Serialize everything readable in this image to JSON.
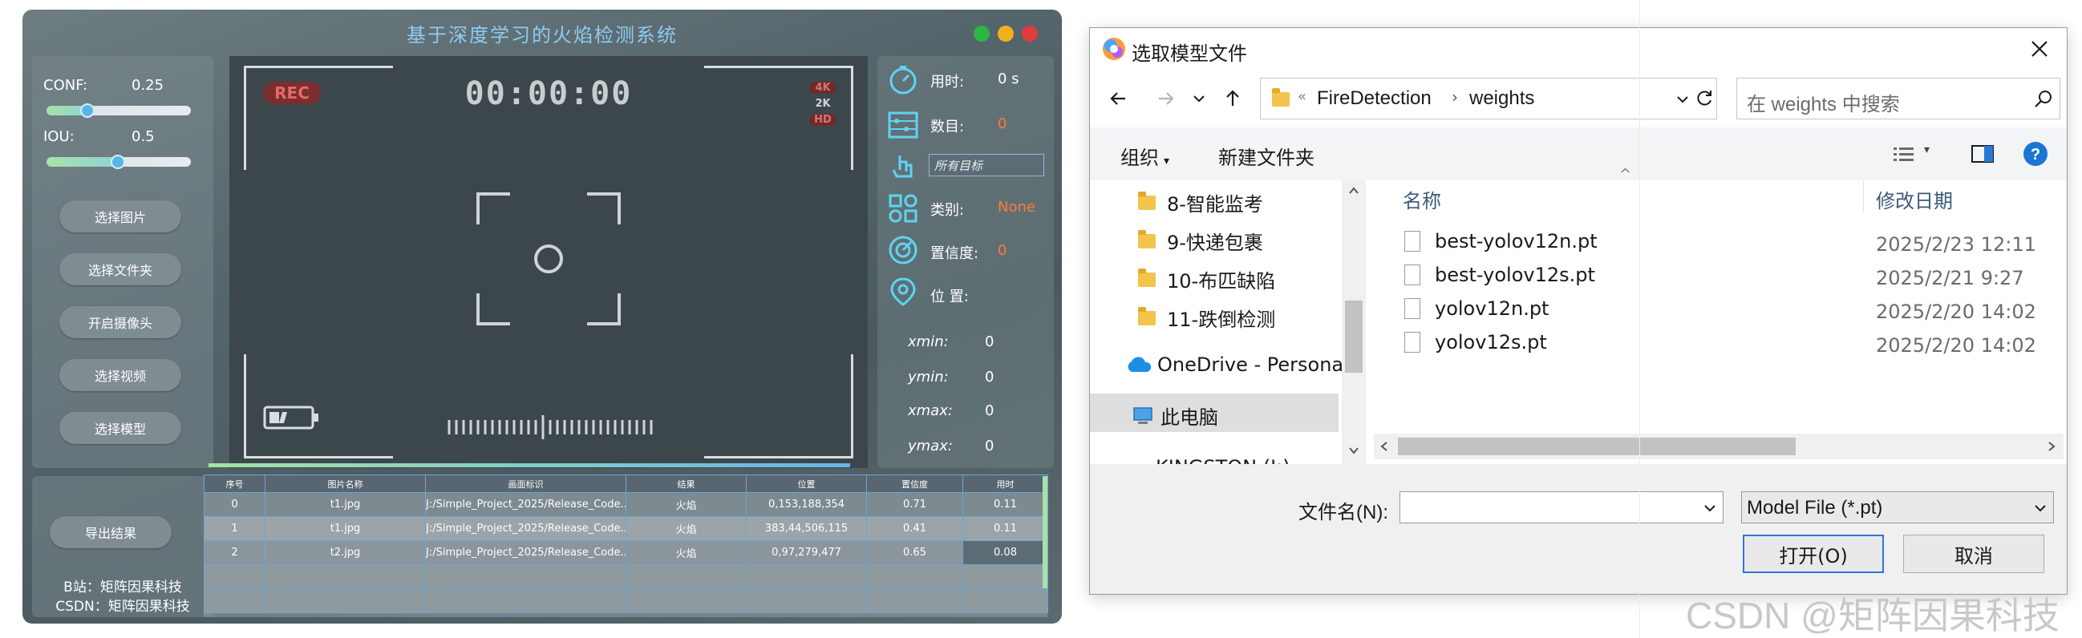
{
  "app": {
    "title": "基于深度学习的火焰检测系统",
    "colors": {
      "close": "#e23b3b",
      "minimize": "#f2b01e",
      "maximize": "#2cb742"
    },
    "conf": {
      "label": "CONF:",
      "value": "0.25",
      "level": 0.25
    },
    "iou": {
      "label": "IOU:",
      "value": "0.5",
      "level": 0.5
    },
    "buttons": {
      "select_image": "选择图片",
      "select_folder": "选择文件夹",
      "open_camera": "开启摄像头",
      "select_video": "选择视频",
      "select_model": "选择模型",
      "export": "导出结果"
    },
    "video": {
      "rec": "REC",
      "timer": "00:00:00",
      "res_4k": "4K",
      "res_2k": "2K",
      "res_hd": "HD"
    },
    "info": {
      "time_label": "用时:",
      "time_value": "0 s",
      "count_label": "数目:",
      "count_value": "0",
      "target_select": "所有目标",
      "class_label": "类别:",
      "class_value": "None",
      "conf_label": "置信度:",
      "conf_value": "0",
      "pos_label": "位 置:",
      "xmin_label": "xmin:",
      "xmin_value": "0",
      "ymin_label": "ymin:",
      "ymin_value": "0",
      "xmax_label": "xmax:",
      "xmax_value": "0",
      "ymax_label": "ymax:",
      "ymax_value": "0"
    },
    "credits": {
      "bilibili": "B站：矩阵因果科技",
      "csdn": "CSDN：矩阵因果科技"
    },
    "table": {
      "headers": [
        "序号",
        "图片名称",
        "画面标识",
        "结果",
        "位置",
        "置信度",
        "用时"
      ],
      "rows": [
        [
          "0",
          "t1.jpg",
          "J:/Simple_Project_2025/Release_Code...",
          "火焰",
          "0,153,188,354",
          "0.71",
          "0.11"
        ],
        [
          "1",
          "t1.jpg",
          "J:/Simple_Project_2025/Release_Code...",
          "火焰",
          "383,44,506,115",
          "0.41",
          "0.11"
        ],
        [
          "2",
          "t2.jpg",
          "J:/Simple_Project_2025/Release_Code...",
          "火焰",
          "0,97,279,477",
          "0.65",
          "0.08"
        ]
      ]
    }
  },
  "dialog": {
    "title": "选取模型文件",
    "breadcrumb": [
      "FireDetection",
      "weights"
    ],
    "search_placeholder": "在 weights 中搜索",
    "toolbar": {
      "organize": "组织",
      "new_folder": "新建文件夹"
    },
    "nav_items": [
      "8-智能监考",
      "9-快递包裹",
      "10-布匹缺陷",
      "11-跌倒检测"
    ],
    "onedrive": "OneDrive - Persona",
    "this_pc": "此电脑",
    "kingston": "KINGSTON (J:)",
    "columns": {
      "name": "名称",
      "date": "修改日期"
    },
    "files": [
      {
        "name": "best-yolov12n.pt",
        "date": "2025/2/23 12:11"
      },
      {
        "name": "best-yolov12s.pt",
        "date": "2025/2/21 9:27"
      },
      {
        "name": "yolov12n.pt",
        "date": "2025/2/20 14:02"
      },
      {
        "name": "yolov12s.pt",
        "date": "2025/2/20 14:02"
      }
    ],
    "filename_label": "文件名(N):",
    "filename_value": "",
    "filetype": "Model File (*.pt)",
    "open_button": "打开(O)",
    "cancel_button": "取消"
  },
  "watermark": "CSDN @矩阵因果科技"
}
